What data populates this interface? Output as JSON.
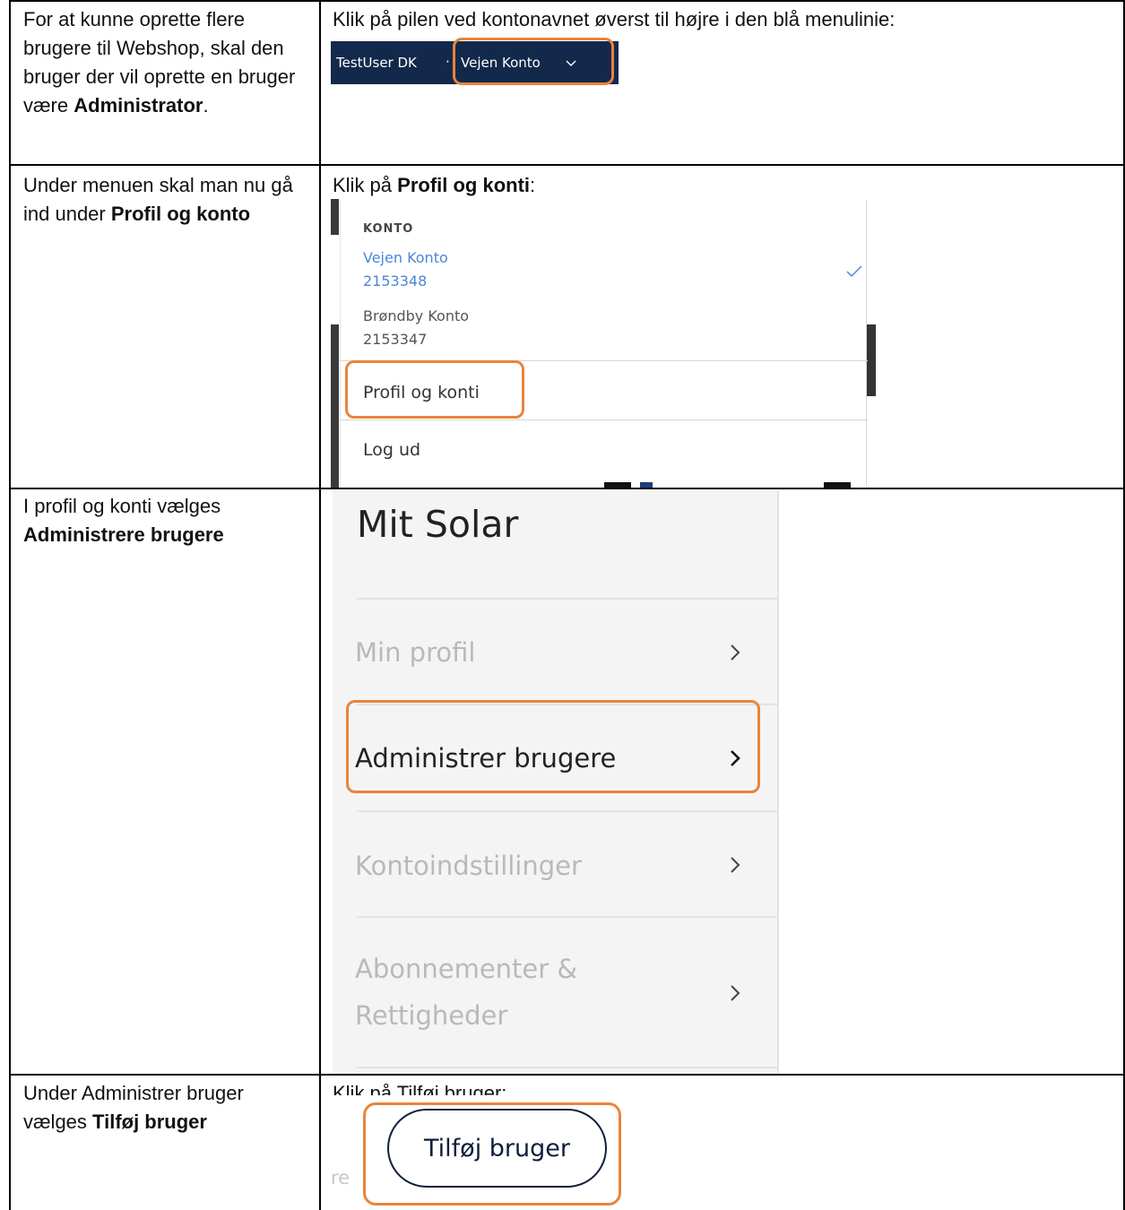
{
  "rows": [
    {
      "left": {
        "prefix": "For at kunne oprette flere brugere til Webshop, skal den bruger der vil oprette en bruger være ",
        "bold": "Administrator",
        "suffix": "."
      },
      "right": {
        "text": "Klik på pilen ved kontonavnet øverst til højre i den blå menulinie:"
      }
    },
    {
      "left": {
        "prefix": "Under menuen skal man nu gå ind under ",
        "bold": "Profil og konto",
        "suffix": ""
      },
      "right": {
        "prefix": "Klik på ",
        "bold": "Profil og konti",
        "suffix": ":"
      }
    },
    {
      "left": {
        "prefix": "I profil og konti vælges ",
        "bold": "Administrere brugere",
        "suffix": ""
      }
    },
    {
      "left": {
        "prefix": "Under Administrer bruger vælges ",
        "bold": "Tilføj bruger",
        "suffix": ""
      },
      "right": {
        "text": "Klik på Tilføj bruger:"
      }
    }
  ],
  "menubar": {
    "user": "TestUser DK",
    "separator": "·",
    "account": "Vejen Konto"
  },
  "dropdown": {
    "header": "KONTO",
    "accounts": [
      {
        "name": "Vejen Konto",
        "id": "2153348",
        "selected": true
      },
      {
        "name": "Brøndby Konto",
        "id": "2153347",
        "selected": false
      }
    ],
    "profile_link": "Profil og konti",
    "logout": "Log ud"
  },
  "solar": {
    "title": "Mit Solar",
    "items": [
      {
        "label": "Min profil",
        "active": false
      },
      {
        "label": "Administrer brugere",
        "active": true
      },
      {
        "label": "Kontoindstillinger",
        "active": false
      },
      {
        "label_line1": "Abonnementer &",
        "label_line2": "Rettigheder",
        "active": false
      }
    ]
  },
  "add_user": {
    "button": "Tilføj bruger",
    "ghost": "re"
  },
  "colors": {
    "highlight": "#e9843b",
    "menubar_bg": "#13294b",
    "selected_account": "#4b86d6",
    "button_border": "#0e1e3d"
  }
}
